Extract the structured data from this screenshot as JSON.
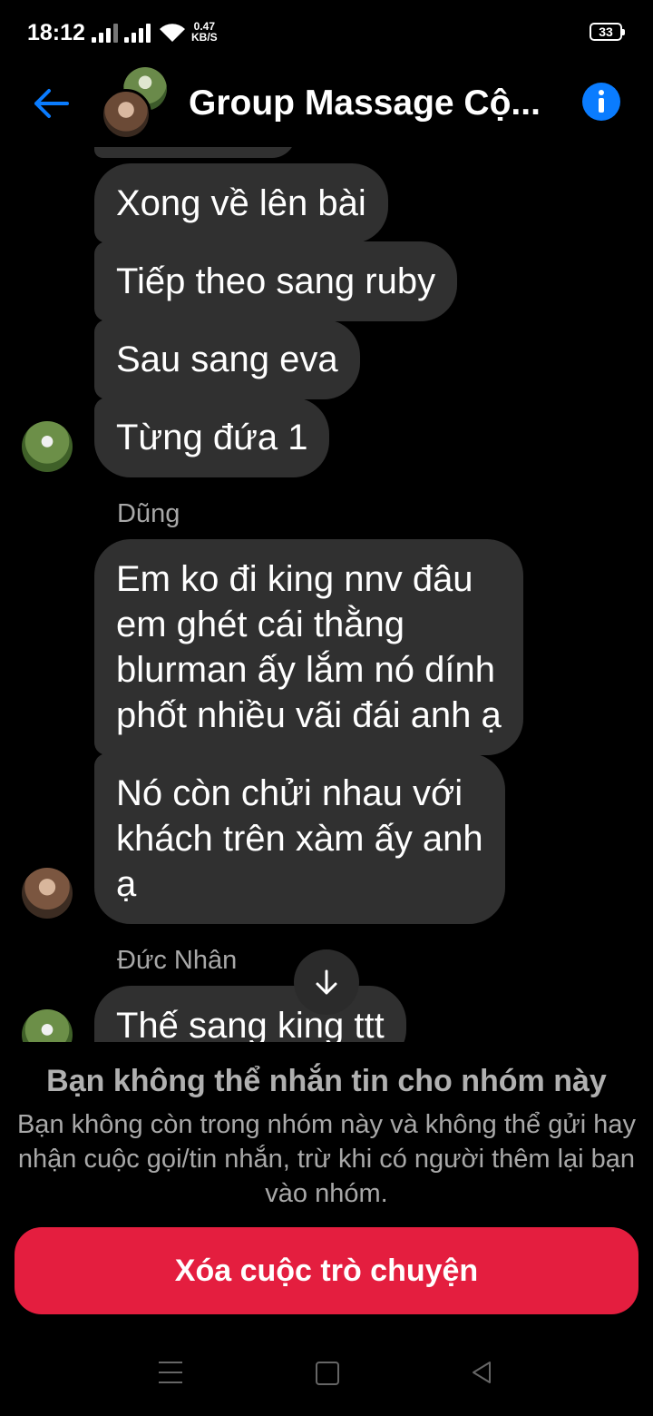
{
  "status_bar": {
    "time": "18:12",
    "net_speed_value": "0.47",
    "net_speed_unit": "KB/S",
    "battery": "33"
  },
  "header": {
    "title": "Group Massage Cộ...",
    "back_icon": "arrow-left-icon",
    "info_icon": "info-icon",
    "accent_color": "#0a7cff"
  },
  "messages": [
    {
      "text": "Xong về lên bài"
    },
    {
      "text": "Tiếp theo sang ruby"
    },
    {
      "text": "Sau sang eva"
    },
    {
      "text": "Từng đứa 1"
    },
    {
      "sender": "Dũng"
    },
    {
      "text": "Em ko đi king nnv đâu\nem ghét cái thằng\nblurman ấy lắm nó dính\nphốt nhiều vãi đái anh ạ"
    },
    {
      "text": "Nó còn chửi nhau với\nkhách trên xàm ấy anh\nạ"
    },
    {
      "sender": "Đức Nhân"
    },
    {
      "text": "Thế sang king ttt"
    }
  ],
  "notice": {
    "title": "Bạn không thể nhắn tin cho nhóm này",
    "body": "Bạn không còn trong nhóm này và không thể gửi hay nhận cuộc gọi/tin nhắn, trừ khi có người thêm lại bạn vào nhóm."
  },
  "delete_button": {
    "label": "Xóa cuộc trò chuyện",
    "color": "#e41e3f"
  }
}
